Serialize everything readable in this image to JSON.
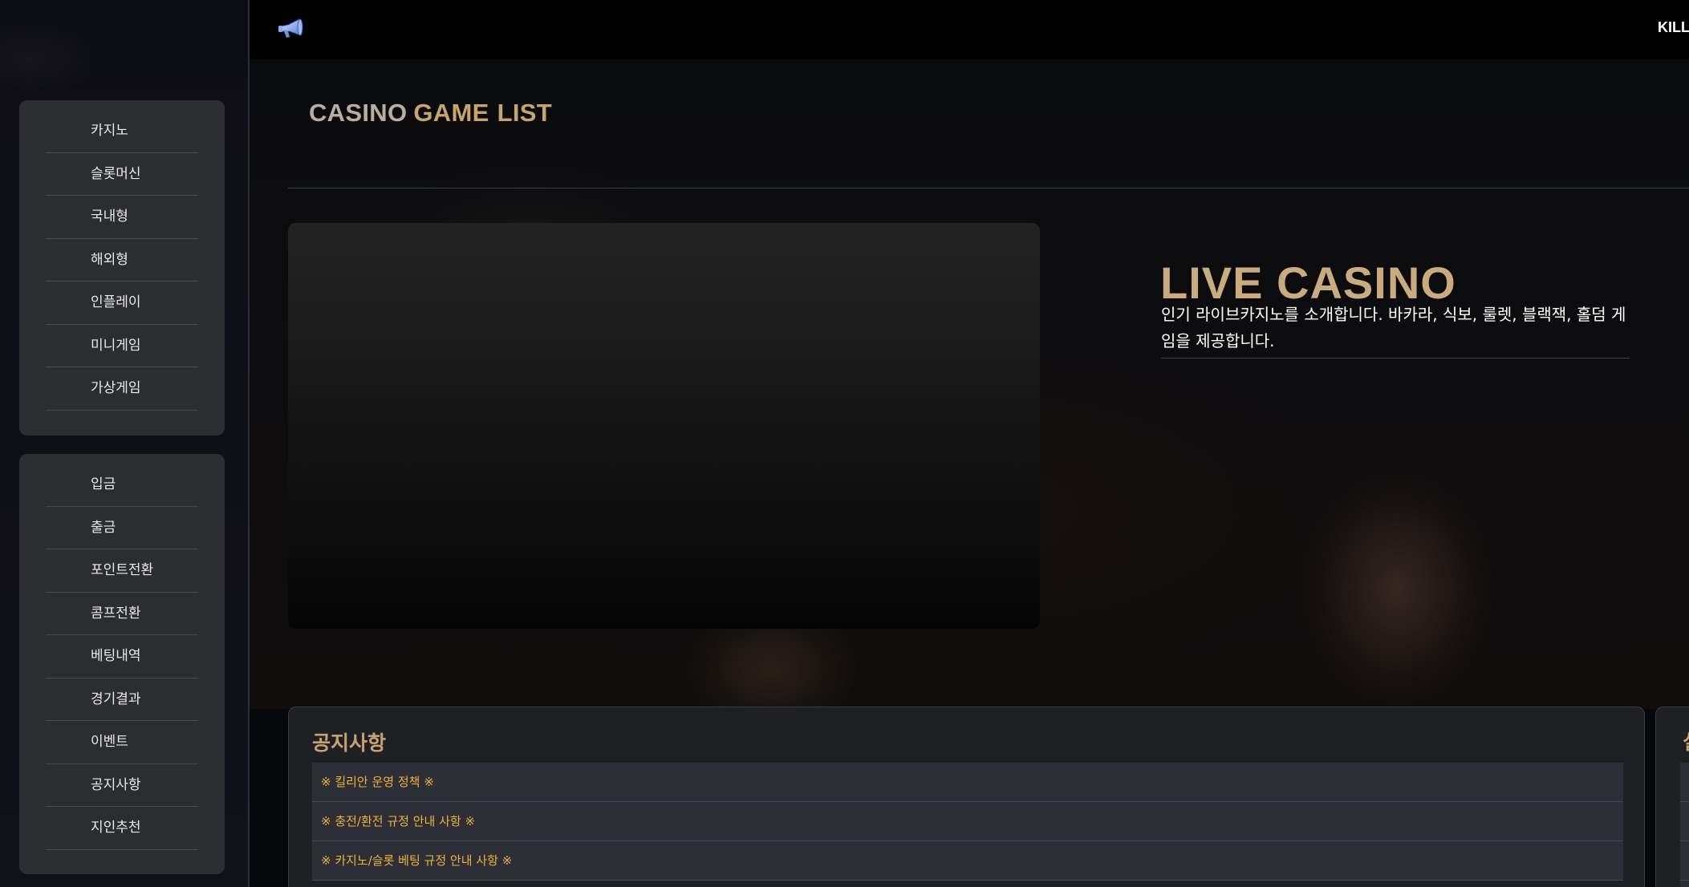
{
  "topbar": {
    "megaphone_icon": "megaphone-icon",
    "right_text": "KILLI"
  },
  "sidebar": {
    "game_menu": [
      {
        "label": "카지노"
      },
      {
        "label": "슬롯머신"
      },
      {
        "label": "국내형"
      },
      {
        "label": "해외형"
      },
      {
        "label": "인플레이"
      },
      {
        "label": "미니게임"
      },
      {
        "label": "가상게임"
      }
    ],
    "account_menu": [
      {
        "label": "입금"
      },
      {
        "label": "출금"
      },
      {
        "label": "포인트전환"
      },
      {
        "label": "콤프전환"
      },
      {
        "label": "베팅내역"
      },
      {
        "label": "경기결과"
      },
      {
        "label": "이벤트"
      },
      {
        "label": "공지사항"
      },
      {
        "label": "지인추천"
      }
    ]
  },
  "main": {
    "section_title": {
      "part1": "CASINO",
      "part2": "GAME",
      "part3": "LIST"
    },
    "live_casino": {
      "title": "LIVE CASINO",
      "description": "인기 라이브카지노를 소개합니다. 바카라, 식보, 룰렛, 블랙잭, 홀덤 게임을 제공합니다."
    },
    "notice": {
      "title": "공지사항",
      "items": [
        {
          "text": "※ 킬리안 운영 정책 ※"
        },
        {
          "text": "※ 충전/환전 규정 안내 사항 ※"
        },
        {
          "text": "※ 카지노/슬롯 베팅 규정 안내 사항 ※"
        }
      ]
    },
    "side_panel": {
      "title": "실"
    }
  },
  "colors": {
    "accent_gold": "#c7a46c",
    "notice_orange": "#f0b040",
    "panel_bg": "#2b2d31"
  }
}
